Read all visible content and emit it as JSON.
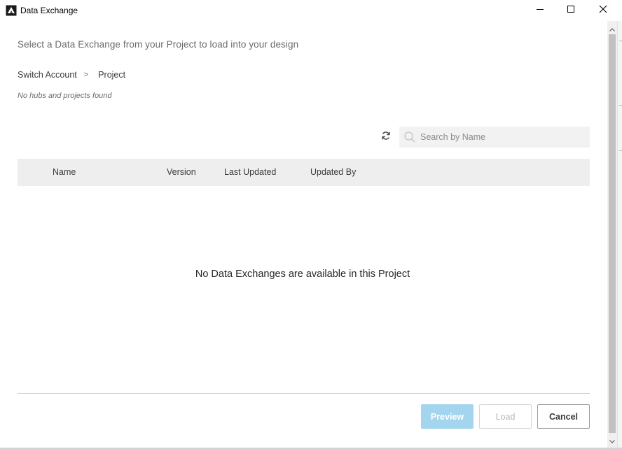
{
  "window": {
    "title": "Data Exchange",
    "icon": "app-logo-icon",
    "controls": [
      "minimize-icon",
      "maximize-icon",
      "close-icon"
    ]
  },
  "dialog": {
    "subtitle": "Select a Data Exchange from your Project to load into your design",
    "breadcrumb": {
      "account": "Switch Account",
      "separator": ">",
      "project": "Project"
    },
    "status_note": "No hubs and projects found",
    "search": {
      "placeholder": "Search by Name",
      "value": ""
    },
    "table": {
      "columns": [
        "Name",
        "Version",
        "Last Updated",
        "Updated By"
      ],
      "rows": []
    },
    "empty_message": "No Data Exchanges are available in this Project",
    "buttons": {
      "preview": "Preview",
      "load": "Load",
      "cancel": "Cancel"
    }
  },
  "colors": {
    "preview_button": "#a3d5ef",
    "table_header": "#eeeeee",
    "search_background": "#f2f2f2"
  }
}
